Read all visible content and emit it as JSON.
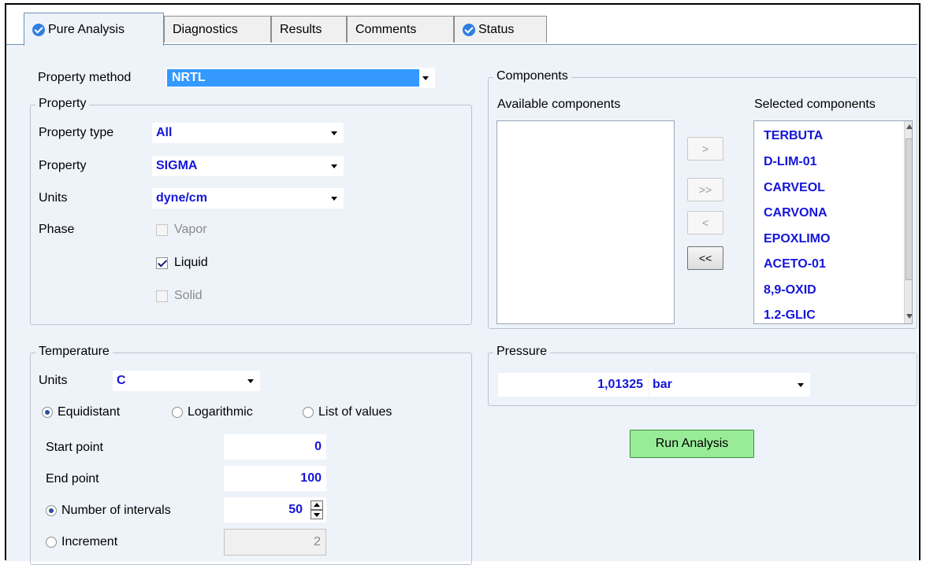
{
  "tabs": [
    {
      "label": "Pure Analysis",
      "icon": "check-circle-icon"
    },
    {
      "label": "Diagnostics"
    },
    {
      "label": "Results"
    },
    {
      "label": "Comments"
    },
    {
      "label": "Status",
      "icon": "check-circle-icon"
    }
  ],
  "property_method": {
    "label": "Property method",
    "value": "NRTL"
  },
  "property": {
    "title": "Property",
    "type_label": "Property type",
    "type_value": "All",
    "property_label": "Property",
    "property_value": "SIGMA",
    "units_label": "Units",
    "units_value": "dyne/cm",
    "phase_label": "Phase",
    "vapor": "Vapor",
    "liquid": "Liquid",
    "solid": "Solid"
  },
  "components": {
    "title": "Components",
    "available_label": "Available components",
    "selected_label": "Selected components",
    "selected": [
      "TERBUTA",
      "D-LIM-01",
      "CARVEOL",
      "CARVONA",
      "EPOXLIMO",
      "ACETO-01",
      "8,9-OXID",
      "1.2-GLIC"
    ],
    "btn_add": ">",
    "btn_add_all": ">>",
    "btn_remove": "<",
    "btn_remove_all": "<<"
  },
  "temperature": {
    "title": "Temperature",
    "units_label": "Units",
    "units_value": "C",
    "equidistant": "Equidistant",
    "logarithmic": "Logarithmic",
    "list": "List of values",
    "start_label": "Start point",
    "start_value": "0",
    "end_label": "End point",
    "end_value": "100",
    "intervals_label": "Number of intervals",
    "intervals_value": "50",
    "increment_label": "Increment",
    "increment_value": "2"
  },
  "pressure": {
    "title": "Pressure",
    "value": "1,01325",
    "units": "bar"
  },
  "run_button": "Run Analysis",
  "colors": {
    "accent_blue": "#1515d8",
    "run_green": "#98ec98",
    "panel_bg": "#eef3fa"
  }
}
